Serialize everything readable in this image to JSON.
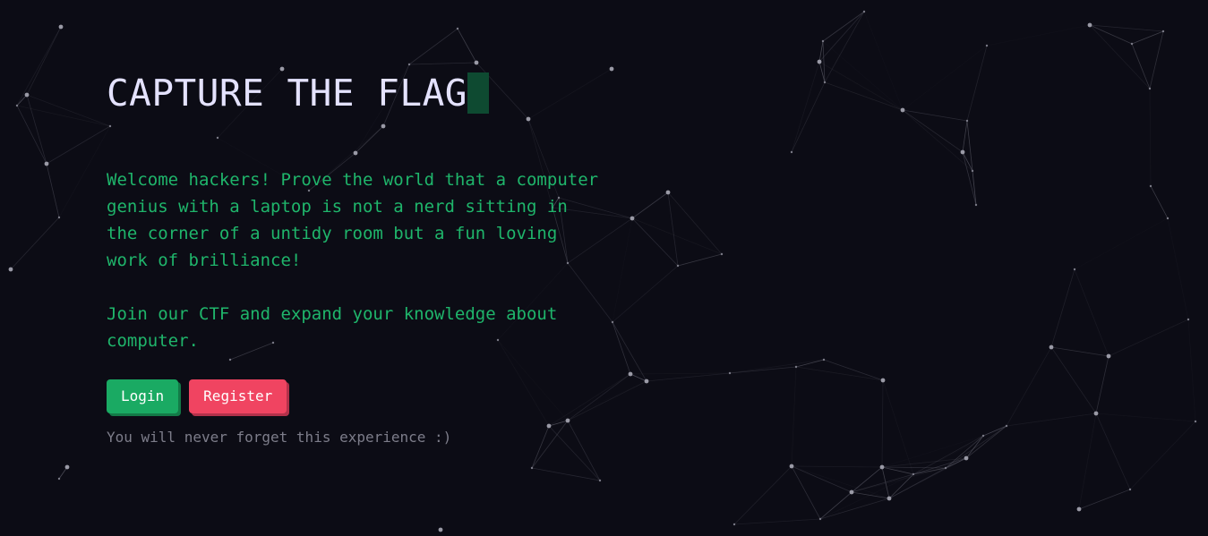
{
  "hero": {
    "title": "CAPTURE THE FLAG",
    "intro_line1": "Welcome hackers! Prove the world that a computer genius with a laptop is not a nerd sitting in the corner of a untidy room but a fun loving work of brilliance!",
    "intro_line2": "Join our CTF and expand your knowledge about computer.",
    "login_label": "Login",
    "register_label": "Register",
    "tagline": "You will never forget this experience :)"
  },
  "colors": {
    "background": "#0c0c15",
    "title": "#e4e2ff",
    "accent_green": "#1fb56b",
    "login_button": "#1aaa63",
    "register_button": "#f04461",
    "muted_text": "#7d7d8a",
    "network_lines": "#5a5a66"
  }
}
